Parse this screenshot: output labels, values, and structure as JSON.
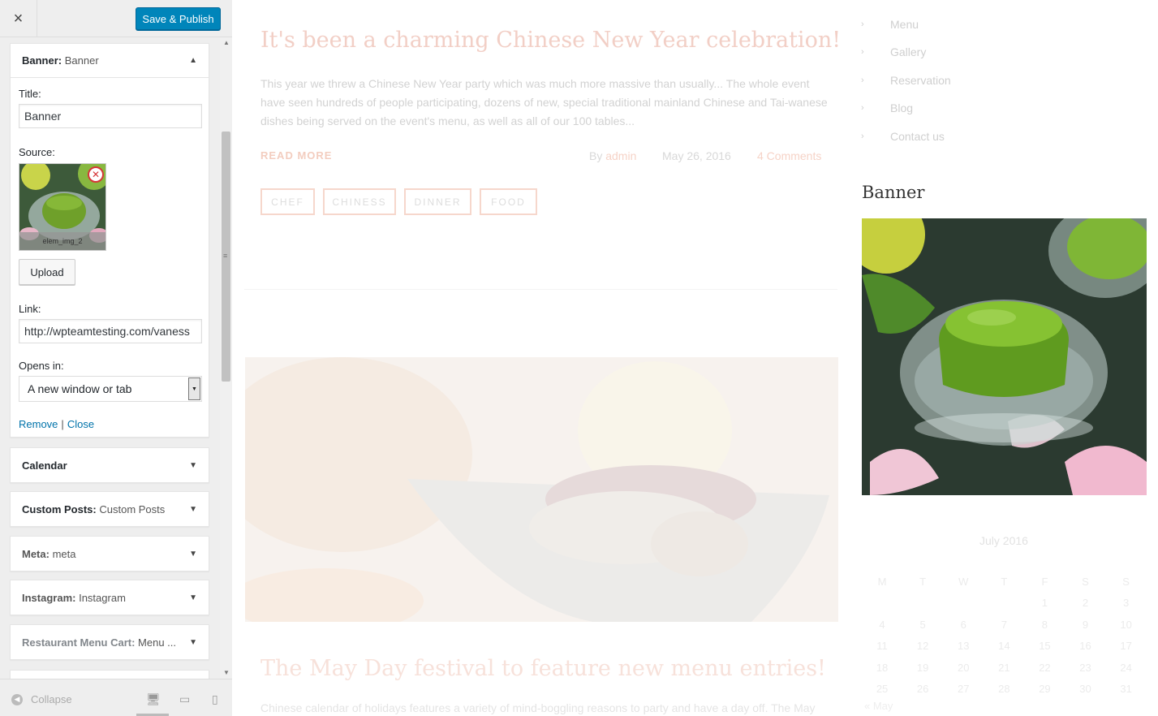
{
  "customizer": {
    "close_label": "×",
    "publish_label": "Save & Publish",
    "banner_widget": {
      "name": "Banner:",
      "instance": "Banner",
      "title_label": "Title:",
      "title_value": "Banner",
      "source_label": "Source:",
      "image_caption": "elem_img_2",
      "upload_label": "Upload",
      "link_label": "Link:",
      "link_value": "http://wpteamtesting.com/vaness",
      "opens_label": "Opens in:",
      "opens_value": "A new window or tab",
      "remove_label": "Remove",
      "separator": "|",
      "close_label": "Close"
    },
    "widgets": [
      {
        "name": "Calendar",
        "instance": ""
      },
      {
        "name": "Custom Posts:",
        "instance": "Custom Posts"
      },
      {
        "name": "Meta:",
        "instance": "meta"
      },
      {
        "name": "Instagram:",
        "instance": "Instagram"
      },
      {
        "name": "Restaurant Menu Cart:",
        "instance": "Menu ..."
      }
    ],
    "footer": {
      "collapse_label": "Collapse"
    }
  },
  "preview": {
    "post1": {
      "title": "It's been a charming Chinese New Year celebration!",
      "excerpt": "This year we threw a Chinese New Year party which was much more massive than usually... The whole event have seen hundreds of people participating, dozens of new, special traditional mainland Chinese and Tai-wanese dishes being served on the event's menu, as well as all of our 100 tables...",
      "read_more": "READ MORE",
      "by": "By",
      "author": "admin",
      "date": "May 26, 2016",
      "comments": "4 Comments",
      "tags": [
        "CHEF",
        "CHINESS",
        "DINNER",
        "FOOD"
      ]
    },
    "post2": {
      "title": "The May Day festival to feature new menu entries!",
      "excerpt": "Chinese calendar of holidays features a variety of mind-boggling reasons to party and have a day off. The May"
    },
    "sidebar_menu": [
      "Menu",
      "Gallery",
      "Reservation",
      "Blog",
      "Contact us"
    ],
    "banner_title": "Banner",
    "calendar": {
      "caption": "July 2016",
      "days": [
        "M",
        "T",
        "W",
        "T",
        "F",
        "S",
        "S"
      ],
      "weeks": [
        [
          "",
          "",
          "",
          "",
          "1",
          "2",
          "3"
        ],
        [
          "4",
          "5",
          "6",
          "7",
          "8",
          "9",
          "10"
        ],
        [
          "11",
          "12",
          "13",
          "14",
          "15",
          "16",
          "17"
        ],
        [
          "18",
          "19",
          "20",
          "21",
          "22",
          "23",
          "24"
        ],
        [
          "25",
          "26",
          "27",
          "28",
          "29",
          "30",
          "31"
        ]
      ],
      "prev": "« May"
    }
  },
  "colors": {
    "accent": "#0085ba",
    "link": "#0073aa",
    "brand_pink": "#f2cfc6"
  }
}
